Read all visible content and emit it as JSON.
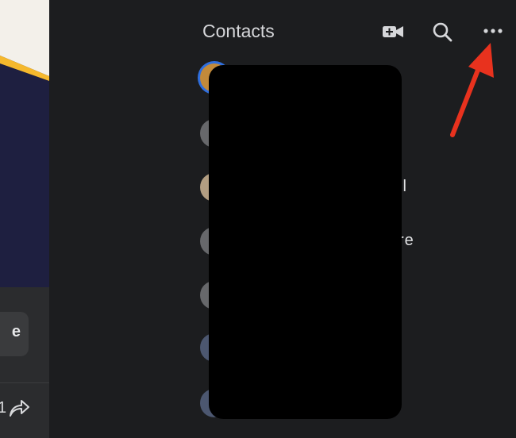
{
  "feed": {
    "action_button_label": "e",
    "reaction_count": "1",
    "share_icon": "share-arrow-icon"
  },
  "contacts": {
    "title": "Contacts",
    "icons": {
      "video": "video-call-icon",
      "search": "search-icon",
      "more": "more-options-icon"
    },
    "rows": [
      {
        "name_fragment": ""
      },
      {
        "name_fragment": ""
      },
      {
        "name_fragment": "ll"
      },
      {
        "name_fragment": "re"
      },
      {
        "name_fragment": ""
      },
      {
        "name_fragment": ""
      },
      {
        "name_fragment": ""
      }
    ]
  },
  "colors": {
    "panel_background": "#1c1d1f",
    "annotation_arrow": "#e8321e",
    "active_ring": "#2f6fdf"
  }
}
